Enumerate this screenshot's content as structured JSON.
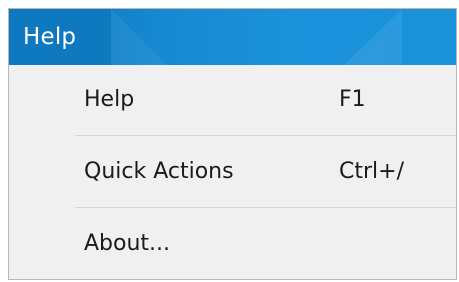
{
  "menu": {
    "title": "Help",
    "items": [
      {
        "label": "Help",
        "shortcut": "F1"
      },
      {
        "label": "Quick Actions",
        "shortcut": "Ctrl+/"
      },
      {
        "label": "About...",
        "shortcut": ""
      }
    ]
  },
  "colors": {
    "menubar_accent": "#1b92db",
    "active_title_bg": "#0f79bf",
    "menu_bg": "#f0f0f0",
    "separator": "#d6d6d6",
    "text": "#1b1b1b"
  }
}
